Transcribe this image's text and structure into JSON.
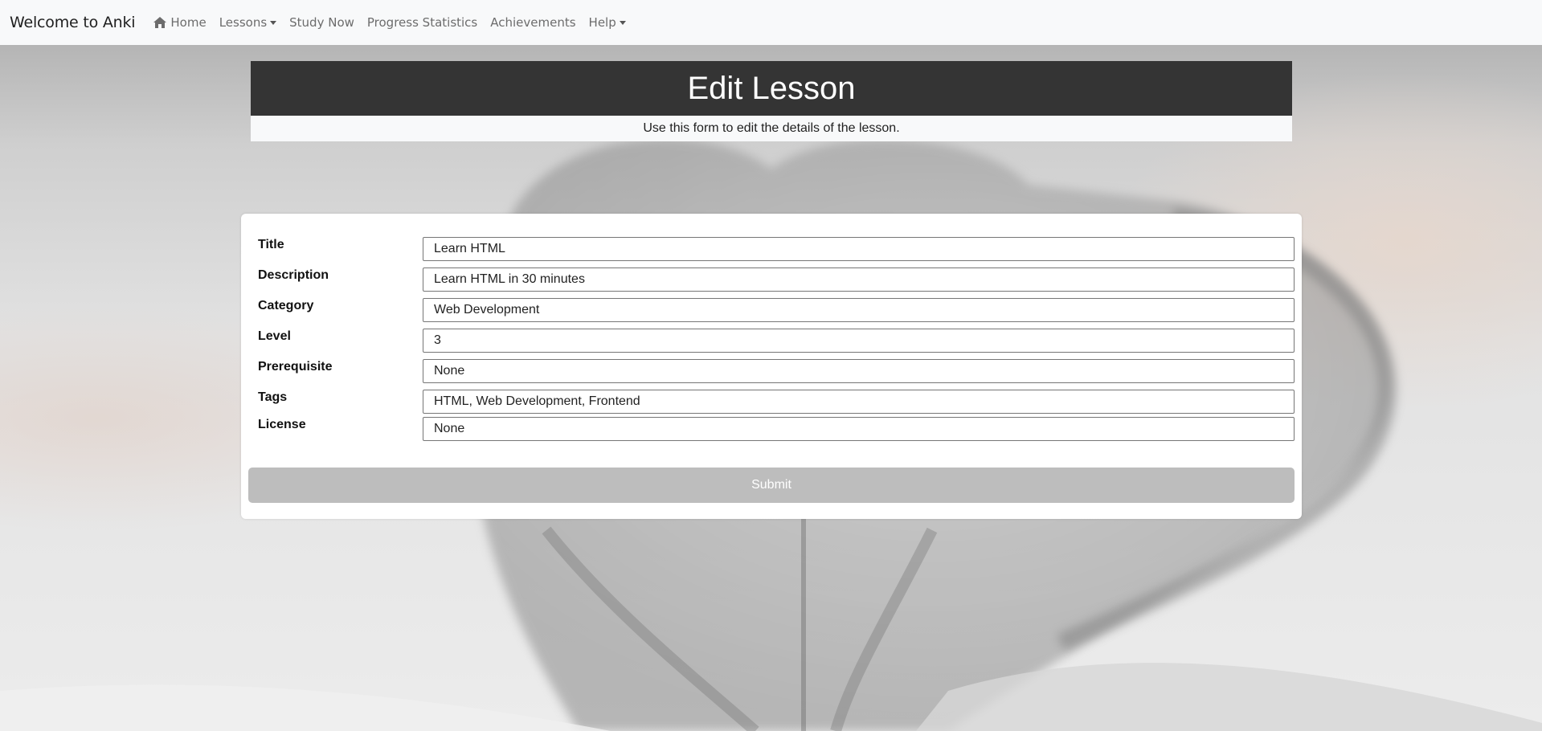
{
  "navbar": {
    "brand": "Welcome to Anki",
    "items": [
      {
        "label": "Home",
        "icon": "home-icon",
        "dropdown": false
      },
      {
        "label": "Lessons",
        "dropdown": true
      },
      {
        "label": "Study Now",
        "dropdown": false
      },
      {
        "label": "Progress Statistics",
        "dropdown": false
      },
      {
        "label": "Achievements",
        "dropdown": false
      },
      {
        "label": "Help",
        "dropdown": true
      }
    ]
  },
  "header": {
    "title": "Edit Lesson",
    "subtitle": "Use this form to edit the details of the lesson."
  },
  "form": {
    "fields": [
      {
        "label": "Title",
        "value": "Learn HTML"
      },
      {
        "label": "Description",
        "value": "Learn HTML in 30 minutes"
      },
      {
        "label": "Category",
        "value": "Web Development"
      },
      {
        "label": "Level",
        "value": "3"
      },
      {
        "label": "Prerequisite",
        "value": "None"
      },
      {
        "label": "Tags",
        "value": "HTML, Web Development, Frontend"
      },
      {
        "label": "License",
        "value": "None"
      }
    ],
    "submit_label": "Submit"
  },
  "colors": {
    "navbar_bg": "#f8f9fa",
    "header_bg": "#343434",
    "submit_bg": "#bdbdbd"
  }
}
